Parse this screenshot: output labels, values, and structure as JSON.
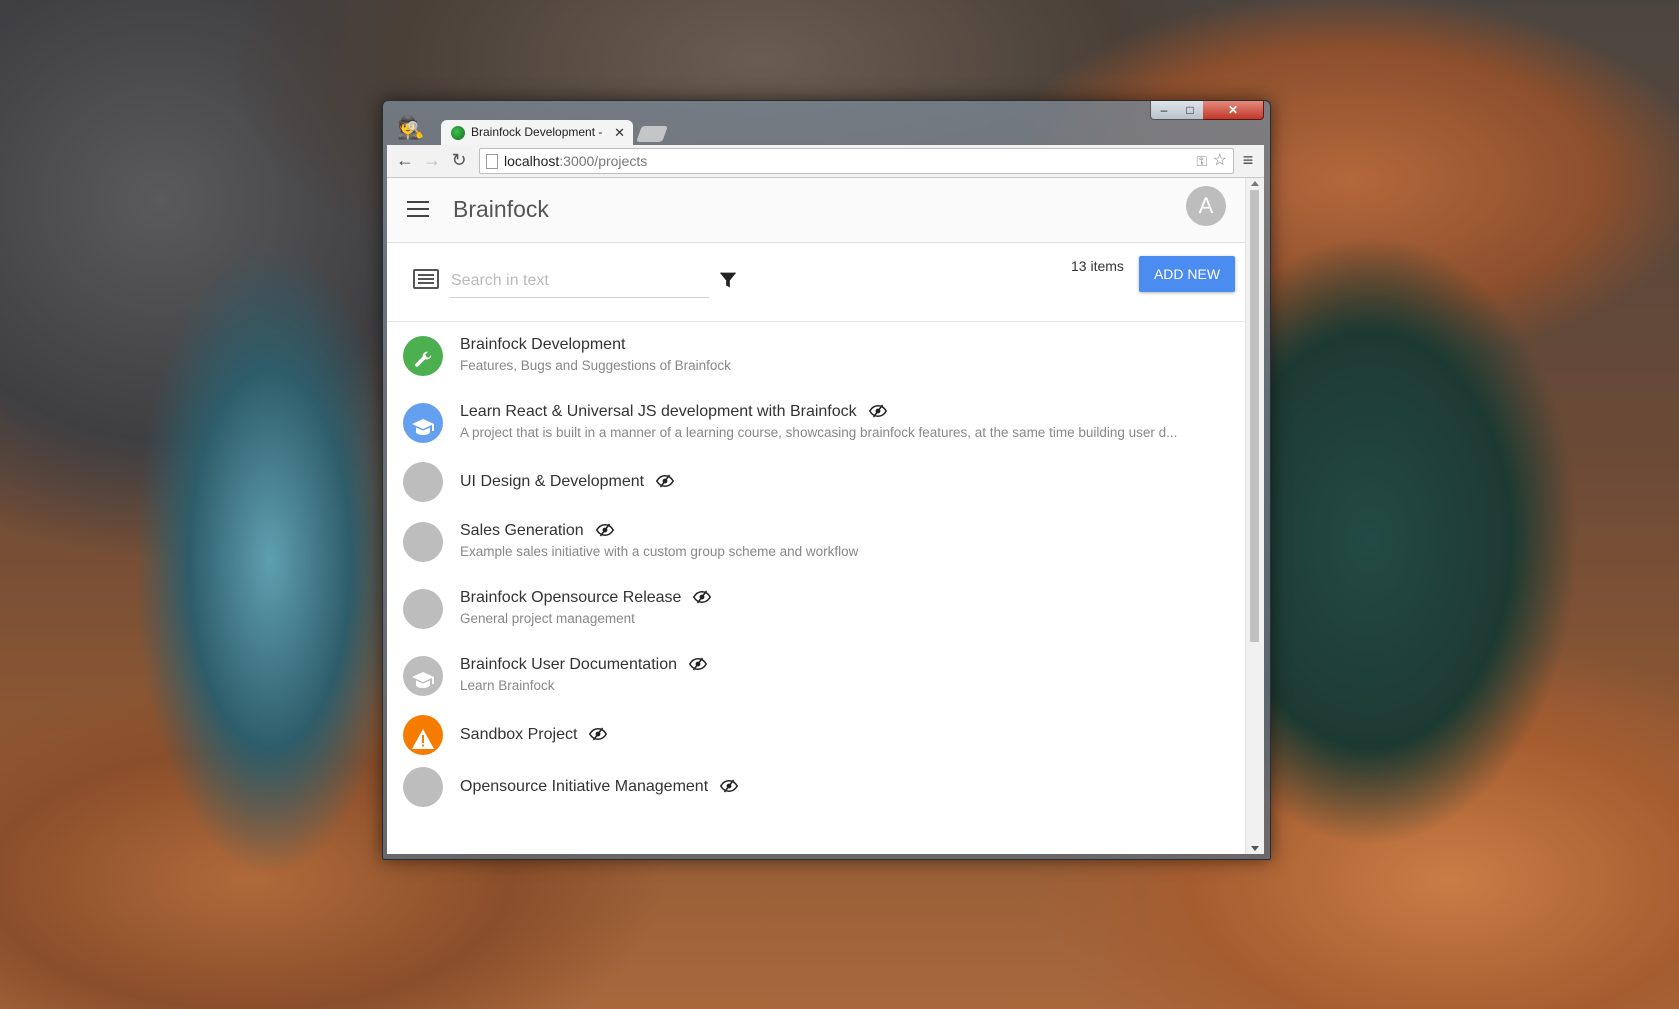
{
  "browser": {
    "tab_title": "Brainfock Development - ",
    "tab_close": "✕",
    "url_host": "localhost",
    "url_path": ":3000/projects",
    "close_glyph": "✕"
  },
  "app": {
    "title": "Brainfock",
    "avatar_letter": "A",
    "search_placeholder": "Search in text",
    "items_count": "13 items",
    "add_button": "ADD NEW"
  },
  "colors": {
    "accent": "#4a8cf0",
    "avatar_green": "#4caf50",
    "avatar_blue": "#64a0ee",
    "avatar_orange": "#f57c00",
    "avatar_grey": "#bdbdbd"
  },
  "projects": [
    {
      "name": "Brainfock Development",
      "description": "Features, Bugs and Suggestions of Brainfock",
      "icon": "wrench-icon",
      "color": "#4caf50",
      "watched": false
    },
    {
      "name": "Learn React & Universal JS development with Brainfock",
      "description": "A project that is built in a manner of a learning course, showcasing brainfock features, at the same time building user d...",
      "icon": "graduation-cap-icon",
      "color": "#64a0ee",
      "watched": true
    },
    {
      "name": "UI Design & Development",
      "description": "",
      "icon": "none",
      "color": "#bdbdbd",
      "watched": true
    },
    {
      "name": "Sales Generation",
      "description": "Example sales initiative with a custom group scheme and workflow",
      "icon": "none",
      "color": "#bdbdbd",
      "watched": true
    },
    {
      "name": "Brainfock Opensource Release",
      "description": "General project management",
      "icon": "none",
      "color": "#bdbdbd",
      "watched": true
    },
    {
      "name": "Brainfock User Documentation",
      "description": "Learn Brainfock",
      "icon": "graduation-cap-icon",
      "color": "#bdbdbd",
      "watched": true
    },
    {
      "name": "Sandbox Project",
      "description": "",
      "icon": "warning-icon",
      "color": "#f57c00",
      "watched": true
    },
    {
      "name": "Opensource Initiative Management",
      "description": "",
      "icon": "none",
      "color": "#bdbdbd",
      "watched": true
    }
  ]
}
